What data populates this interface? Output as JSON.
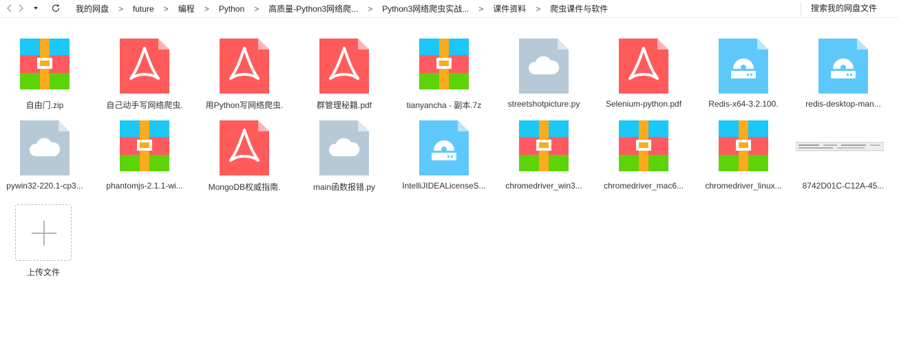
{
  "toolbar": {
    "back_icon": "chevron-left-icon",
    "forward_icon": "chevron-right-icon",
    "history_icon": "caret-down-icon",
    "refresh_icon": "refresh-icon",
    "search_link": "搜索我的网盘文件"
  },
  "breadcrumbs": [
    "我的网盘",
    "future",
    "编程",
    "Python",
    "高质量-Python3网络爬...",
    "Python3网络爬虫实战...",
    "课件资料",
    "爬虫课件与软件"
  ],
  "files": [
    {
      "name": "自由门.zip",
      "type": "archive"
    },
    {
      "name": "自己动手写网络爬虫.",
      "type": "pdf"
    },
    {
      "name": "用Python写网络爬虫.",
      "type": "pdf"
    },
    {
      "name": "群管理秘籍.pdf",
      "type": "pdf"
    },
    {
      "name": "tianyancha - 副本.7z",
      "type": "archive"
    },
    {
      "name": "streetshotpicture.py",
      "type": "cloud"
    },
    {
      "name": "Selenium-python.pdf",
      "type": "pdf"
    },
    {
      "name": "Redis-x64-3.2.100.",
      "type": "installer"
    },
    {
      "name": "redis-desktop-man...",
      "type": "installer"
    },
    {
      "name": "pywin32-220.1-cp3...",
      "type": "cloud"
    },
    {
      "name": "phantomjs-2.1.1-wi...",
      "type": "archive"
    },
    {
      "name": "MongoDB权威指南.",
      "type": "pdf"
    },
    {
      "name": "main函数报错.py",
      "type": "cloud"
    },
    {
      "name": "IntelliJIDEALicenseS...",
      "type": "installer"
    },
    {
      "name": "chromedriver_win3...",
      "type": "archive"
    },
    {
      "name": "chromedriver_mac6...",
      "type": "archive"
    },
    {
      "name": "chromedriver_linux...",
      "type": "archive"
    },
    {
      "name": "8742D01C-C12A-45...",
      "type": "image"
    }
  ],
  "upload": {
    "label": "上传文件",
    "icon": "plus-icon"
  },
  "colors": {
    "pdf_red": "#FF5B5B",
    "cloud_grey": "#B6C9D6",
    "installer_blue": "#5FC8FB",
    "archive_blue": "#1BC8F8",
    "archive_red": "#FF5A5F",
    "archive_green": "#5DD30A",
    "archive_orange": "#FCAA1E"
  }
}
